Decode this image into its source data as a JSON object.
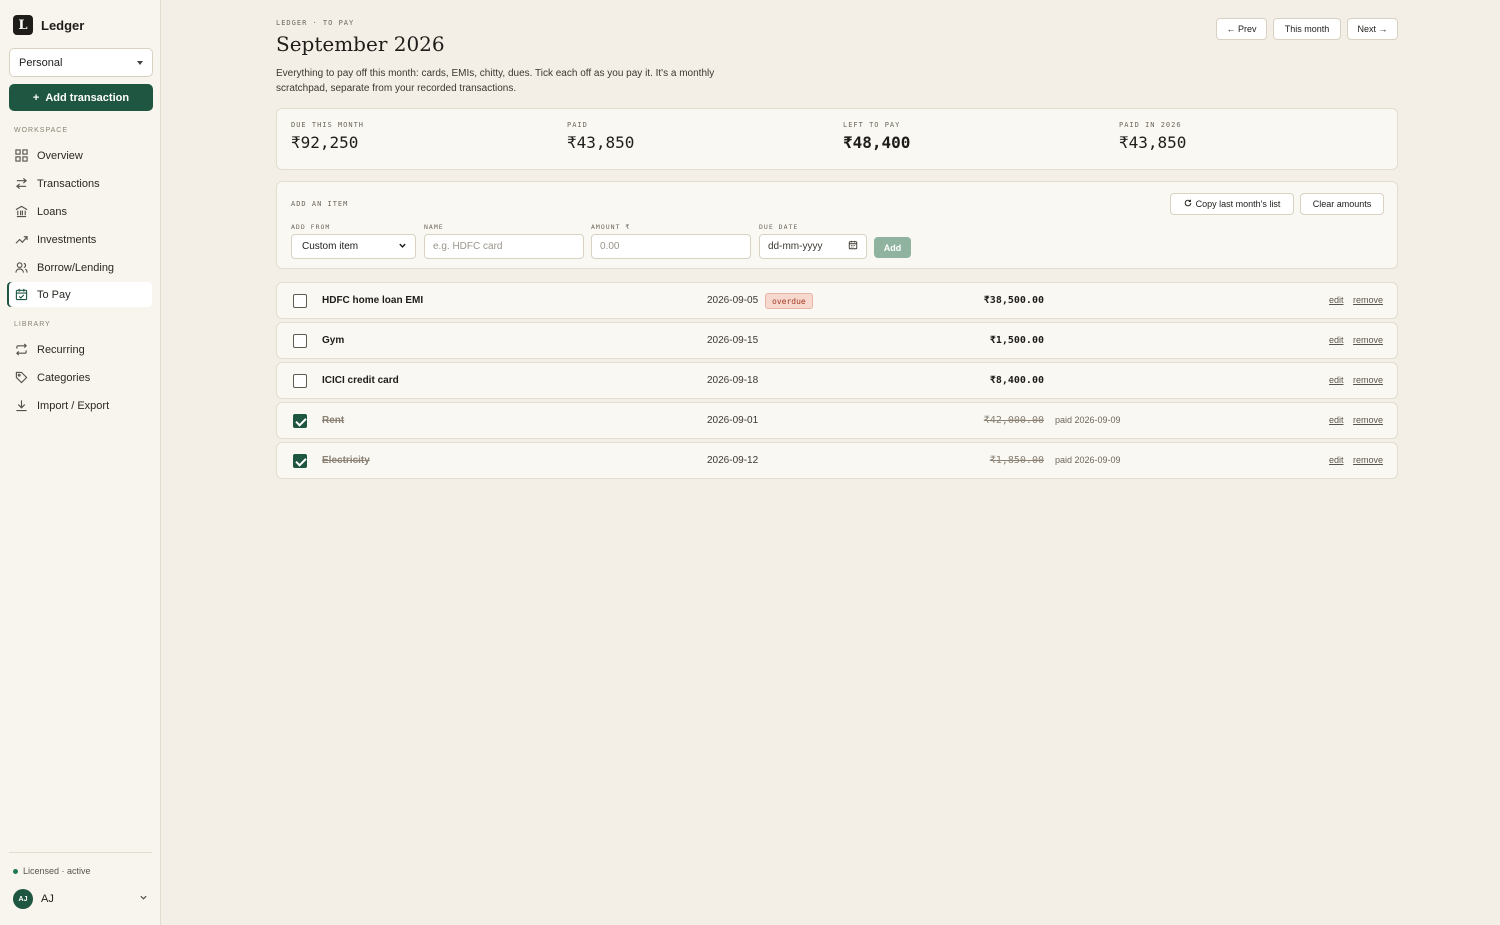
{
  "app": {
    "name": "Ledger",
    "logo_letter": "L"
  },
  "sidebar": {
    "account": "Personal",
    "add_transaction": "Add transaction",
    "workspace_label": "WORKSPACE",
    "library_label": "LIBRARY",
    "workspace_items": [
      {
        "label": "Overview",
        "icon": "grid-icon"
      },
      {
        "label": "Transactions",
        "icon": "arrows-swap-icon"
      },
      {
        "label": "Loans",
        "icon": "bank-icon"
      },
      {
        "label": "Investments",
        "icon": "trend-up-icon"
      },
      {
        "label": "Borrow/Lending",
        "icon": "people-icon"
      },
      {
        "label": "To Pay",
        "icon": "calendar-check-icon",
        "active": true
      }
    ],
    "library_items": [
      {
        "label": "Recurring",
        "icon": "repeat-icon"
      },
      {
        "label": "Categories",
        "icon": "tag-icon"
      },
      {
        "label": "Import / Export",
        "icon": "download-icon"
      }
    ],
    "license": "Licensed · active",
    "user": {
      "initials": "AJ",
      "name": "AJ"
    }
  },
  "header": {
    "eyebrow": "LEDGER · TO PAY",
    "title": "September 2026",
    "description": "Everything to pay off this month: cards, EMIs, chitty, dues. Tick each off as you pay it. It's a monthly scratchpad, separate from your recorded transactions.",
    "prev": "← Prev",
    "this_month": "This month",
    "next": "Next →"
  },
  "stats": [
    {
      "label": "DUE THIS MONTH",
      "value": "₹92,250"
    },
    {
      "label": "PAID",
      "value": "₹43,850"
    },
    {
      "label": "LEFT TO PAY",
      "value": "₹48,400"
    },
    {
      "label": "PAID IN 2026",
      "value": "₹43,850"
    }
  ],
  "add_item": {
    "title": "ADD AN ITEM",
    "copy_last": "Copy last month's list",
    "clear_amounts": "Clear amounts",
    "add_from_label": "ADD FROM",
    "add_from_value": "Custom item",
    "name_label": "NAME",
    "name_placeholder": "e.g. HDFC card",
    "amount_label": "AMOUNT ₹",
    "amount_placeholder": "0.00",
    "due_label": "DUE DATE",
    "due_placeholder": "dd-mm-yyyy",
    "add_button": "Add"
  },
  "items": [
    {
      "name": "HDFC home loan EMI",
      "date": "2026-09-05",
      "badge": "overdue",
      "amount": "₹38,500.00",
      "paid": false,
      "paid_note": ""
    },
    {
      "name": "Gym",
      "date": "2026-09-15",
      "badge": "",
      "amount": "₹1,500.00",
      "paid": false,
      "paid_note": ""
    },
    {
      "name": "ICICI credit card",
      "date": "2026-09-18",
      "badge": "",
      "amount": "₹8,400.00",
      "paid": false,
      "paid_note": ""
    },
    {
      "name": "Rent",
      "date": "2026-09-01",
      "badge": "",
      "amount": "₹42,000.00",
      "paid": true,
      "paid_note": "paid 2026-09-09"
    },
    {
      "name": "Electricity",
      "date": "2026-09-12",
      "badge": "",
      "amount": "₹1,850.00",
      "paid": true,
      "paid_note": "paid 2026-09-09"
    }
  ],
  "row_actions": {
    "edit": "edit",
    "remove": "remove"
  }
}
